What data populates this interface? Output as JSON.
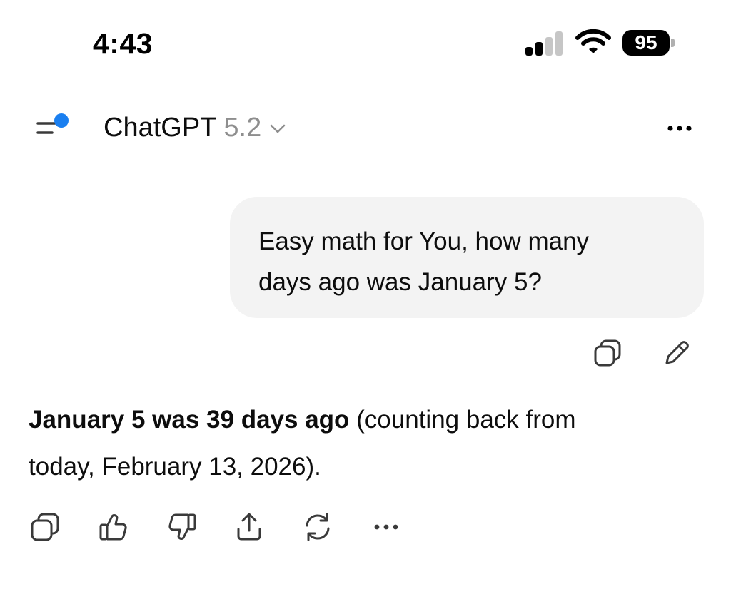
{
  "status_bar": {
    "time": "4:43",
    "battery": "95",
    "icons": [
      "cellular-signal-icon",
      "wifi-icon",
      "battery-icon"
    ]
  },
  "header": {
    "title": "ChatGPT",
    "version": "5.2",
    "icons": [
      "sidebar-menu-icon",
      "chevron-down-icon",
      "more-options-icon"
    ],
    "accent_dot_color": "#1a7ff0"
  },
  "conversation": {
    "user_message": {
      "line1": "Easy math for You, how many",
      "line2": "days ago was January 5?",
      "actions": [
        "copy-icon",
        "edit-pencil-icon"
      ]
    },
    "assistant_message": {
      "bold": "January 5 was 39 days ago",
      "rest_line1": " (counting back from",
      "line2": "today, February 13, 2026).",
      "actions": [
        "copy-icon",
        "thumbs-up-icon",
        "thumbs-down-icon",
        "share-icon",
        "regenerate-icon",
        "more-options-icon"
      ]
    }
  },
  "colors": {
    "bubble_bg": "#f3f3f3",
    "text": "#0d0d0d",
    "muted": "#8e8e8e"
  }
}
